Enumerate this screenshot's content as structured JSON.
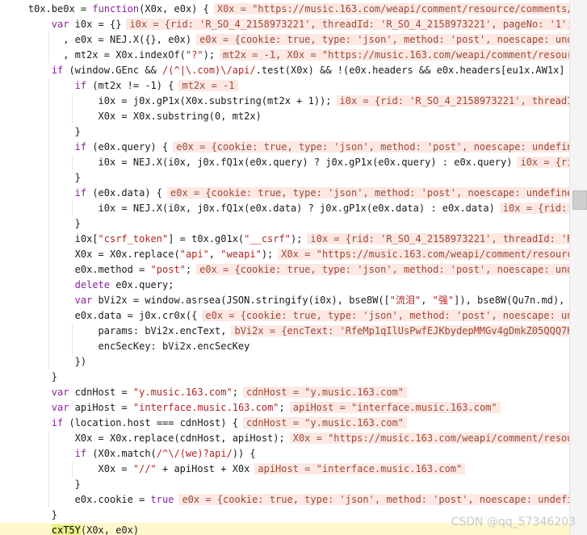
{
  "lines": [
    {
      "indent": 2,
      "tokens": [
        {
          "t": "t0x.be0x = "
        },
        {
          "t": "function",
          "k": "kw"
        },
        {
          "t": "(X0x, e0x) {"
        }
      ],
      "ann": "X0x = \"https://music.163.com/weapi/comment/resource/comments/get\""
    },
    {
      "indent": 4,
      "tokens": [
        {
          "t": "var ",
          "k": "kw"
        },
        {
          "t": "i0x = {}"
        }
      ],
      "ann": "i0x = {rid: 'R_SO_4_2158973221', threadId: 'R_SO_4_2158973221', pageNo: '1', pageSize"
    },
    {
      "indent": 5,
      "tokens": [
        {
          "t": ", e0x = NEJ.X({}, e0x)"
        }
      ],
      "ann": "e0x = {cookie: true, type: 'json', method: 'post', noescape: undefined"
    },
    {
      "indent": 5,
      "tokens": [
        {
          "t": ", mt2x = X0x.indexOf("
        },
        {
          "t": "\"?\"",
          "k": "str"
        },
        {
          "t": ");"
        }
      ],
      "ann": "mt2x = -1, X0x = \"https://music.163.com/weapi/comment/resource"
    },
    {
      "indent": 4,
      "tokens": [
        {
          "t": "if ",
          "k": "kw"
        },
        {
          "t": "(window.GEnc && "
        },
        {
          "t": "/(^|\\.com)\\/api/",
          "k": "str"
        },
        {
          "t": ".test(X0x) && !(e0x.headers && e0x.headers[eu1x.AW1x] == e"
        }
      ],
      "ann": ""
    },
    {
      "indent": 6,
      "tokens": [
        {
          "t": "if ",
          "k": "kw"
        },
        {
          "t": "(mt2x != -1) {"
        }
      ],
      "ann": "mt2x = -1"
    },
    {
      "indent": 8,
      "tokens": [
        {
          "t": "i0x = j0x.gP1x(X0x.substring(mt2x + 1));"
        }
      ],
      "ann": "i0x = {rid: 'R_SO_4_2158973221', threadId"
    },
    {
      "indent": 8,
      "tokens": [
        {
          "t": "X0x = X0x.substring(0, mt2x)"
        }
      ],
      "ann": ""
    },
    {
      "indent": 6,
      "tokens": [
        {
          "t": "}"
        }
      ],
      "ann": ""
    },
    {
      "indent": 6,
      "tokens": [
        {
          "t": "if ",
          "k": "kw"
        },
        {
          "t": "(e0x.query) {"
        }
      ],
      "ann": "e0x = {cookie: true, type: 'json', method: 'post', noescape: undefined"
    },
    {
      "indent": 8,
      "tokens": [
        {
          "t": "i0x = NEJ.X(i0x, j0x.fQ1x(e0x.query) ? j0x.gP1x(e0x.query) : e0x.query)"
        }
      ],
      "ann": "i0x = {rid"
    },
    {
      "indent": 6,
      "tokens": [
        {
          "t": "}"
        }
      ],
      "ann": ""
    },
    {
      "indent": 6,
      "tokens": [
        {
          "t": "if ",
          "k": "kw"
        },
        {
          "t": "(e0x.data) {"
        }
      ],
      "ann": "e0x = {cookie: true, type: 'json', method: 'post', noescape: undefined,"
    },
    {
      "indent": 8,
      "tokens": [
        {
          "t": "i0x = NEJ.X(i0x, j0x.fQ1x(e0x.data) ? j0x.gP1x(e0x.data) : e0x.data)"
        }
      ],
      "ann": "i0x = {rid: 'R"
    },
    {
      "indent": 6,
      "tokens": [
        {
          "t": "}"
        }
      ],
      "ann": ""
    },
    {
      "indent": 6,
      "tokens": [
        {
          "t": "i0x["
        },
        {
          "t": "\"csrf_token\"",
          "k": "str"
        },
        {
          "t": "] = t0x.g01x("
        },
        {
          "t": "\"__csrf\"",
          "k": "str"
        },
        {
          "t": ");"
        }
      ],
      "ann": "i0x = {rid: 'R_SO_4_2158973221', threadId: 'R_S"
    },
    {
      "indent": 6,
      "tokens": [
        {
          "t": "X0x = X0x.replace("
        },
        {
          "t": "\"api\"",
          "k": "str"
        },
        {
          "t": ", "
        },
        {
          "t": "\"weapi\"",
          "k": "str"
        },
        {
          "t": ");"
        }
      ],
      "ann": "X0x = \"https://music.163.com/weapi/comment/resource"
    },
    {
      "indent": 6,
      "tokens": [
        {
          "t": "e0x.method = "
        },
        {
          "t": "\"post\"",
          "k": "str"
        },
        {
          "t": ";"
        }
      ],
      "ann": "e0x = {cookie: true, type: 'json', method: 'post', noescape: undef"
    },
    {
      "indent": 6,
      "tokens": [
        {
          "t": "delete ",
          "k": "kw"
        },
        {
          "t": "e0x.query;"
        }
      ],
      "ann": ""
    },
    {
      "indent": 6,
      "tokens": [
        {
          "t": "var ",
          "k": "kw"
        },
        {
          "t": "bVi2x = window.asrsea(JSON.stringify(i0x), bse8W(["
        },
        {
          "t": "\"流泪\"",
          "k": "str"
        },
        {
          "t": ", "
        },
        {
          "t": "\"强\"",
          "k": "str"
        },
        {
          "t": "]), bse8W(Qu7n.md), bse8"
        }
      ],
      "ann": ""
    },
    {
      "indent": 6,
      "tokens": [
        {
          "t": "e0x.data = j0x.cr0x({"
        }
      ],
      "ann": "e0x = {cookie: true, type: 'json', method: 'post', noescape: unde"
    },
    {
      "indent": 8,
      "tokens": [
        {
          "t": "params: bVi2x.encText,"
        }
      ],
      "ann": "bVi2x = {encText: 'RfeMp1qIlUsPwfEJKbydepMMGv4gDmkZ05QQQ7HQG"
    },
    {
      "indent": 8,
      "tokens": [
        {
          "t": "encSecKey: bVi2x.encSecKey"
        }
      ],
      "ann": ""
    },
    {
      "indent": 6,
      "tokens": [
        {
          "t": "})"
        }
      ],
      "ann": ""
    },
    {
      "indent": 4,
      "tokens": [
        {
          "t": "}"
        }
      ],
      "ann": ""
    },
    {
      "indent": 4,
      "tokens": [
        {
          "t": "var ",
          "k": "kw"
        },
        {
          "t": "cdnHost = "
        },
        {
          "t": "\"y.music.163.com\"",
          "k": "str"
        },
        {
          "t": ";"
        }
      ],
      "ann": "cdnHost = \"y.music.163.com\""
    },
    {
      "indent": 4,
      "tokens": [
        {
          "t": "var ",
          "k": "kw"
        },
        {
          "t": "apiHost = "
        },
        {
          "t": "\"interface.music.163.com\"",
          "k": "str"
        },
        {
          "t": ";"
        }
      ],
      "ann": "apiHost = \"interface.music.163.com\""
    },
    {
      "indent": 4,
      "tokens": [
        {
          "t": "if ",
          "k": "kw"
        },
        {
          "t": "(location.host === cdnHost) {"
        }
      ],
      "ann": "cdnHost = \"y.music.163.com\""
    },
    {
      "indent": 6,
      "tokens": [
        {
          "t": "X0x = X0x.replace(cdnHost, apiHost);"
        }
      ],
      "ann": "X0x = \"https://music.163.com/weapi/comment/resourc"
    },
    {
      "indent": 6,
      "tokens": [
        {
          "t": "if ",
          "k": "kw"
        },
        {
          "t": "(X0x.match("
        },
        {
          "t": "/^\\/(we)?api/",
          "k": "str"
        },
        {
          "t": ")) {"
        }
      ],
      "ann": ""
    },
    {
      "indent": 8,
      "tokens": [
        {
          "t": "X0x = "
        },
        {
          "t": "\"//\"",
          "k": "str"
        },
        {
          "t": " + apiHost + X0x"
        }
      ],
      "ann": "apiHost = \"interface.music.163.com\""
    },
    {
      "indent": 6,
      "tokens": [
        {
          "t": "}"
        }
      ],
      "ann": ""
    },
    {
      "indent": 6,
      "tokens": [
        {
          "t": "e0x.cookie = "
        },
        {
          "t": "true",
          "k": "kw"
        }
      ],
      "ann": "e0x = {cookie: true, type: 'json', method: 'post', noescape: undefin"
    },
    {
      "indent": 4,
      "tokens": [
        {
          "t": "}"
        }
      ],
      "ann": ""
    },
    {
      "indent": 4,
      "current": true,
      "tokens": [
        {
          "t": "cxT5Y",
          "k": "hl"
        },
        {
          "t": "(X0x, e0x)"
        }
      ],
      "ann": ""
    }
  ],
  "watermark": "CSDN @qq_57346203"
}
